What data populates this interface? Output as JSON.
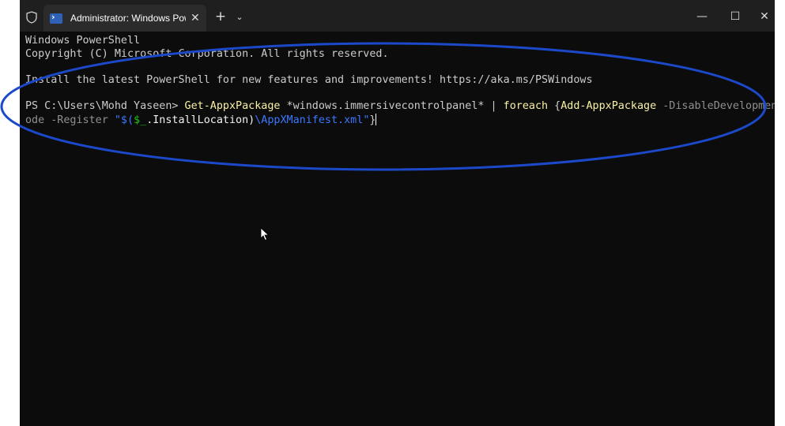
{
  "window": {
    "tab_title": "Administrator: Windows PowerShell",
    "tab_close": "✕",
    "new_tab": "+",
    "dropdown": "⌄",
    "minimize": "—",
    "maximize": "☐",
    "close": "✕"
  },
  "terminal": {
    "line1": "Windows PowerShell",
    "line2": "Copyright (C) Microsoft Corporation. All rights reserved.",
    "line3": "Install the latest PowerShell for new features and improvements! https://aka.ms/PSWindows",
    "prompt": "PS C:\\Users\\Mohd Yaseen> ",
    "cmd": "Get-AppxPackage",
    "arg": " *windows.immersivecontrolpanel* | ",
    "foreach": "foreach",
    "brace_open": " {",
    "cmd2": "Add-AppxPackage",
    "param1": " -DisableDevelopmentM",
    "param1_cont": "ode",
    "param2": " -Register ",
    "str_open": "\"$(",
    "var": "$_",
    "prop": ".InstallLocation)",
    "path": "\\AppXManifest.xml",
    "str_close": "\"",
    "brace_close": "}"
  },
  "colors": {
    "background": "#0c0c0c",
    "titlebar": "#1f1f1f",
    "command": "#f9f1a5",
    "parameter": "#909090",
    "string": "#3b78ff",
    "variable": "#16c60c",
    "annotation": "#1b49c9"
  },
  "icons": {
    "shield": "shield-icon",
    "tab": "powershell-icon",
    "cursor": "mouse-pointer-icon"
  }
}
